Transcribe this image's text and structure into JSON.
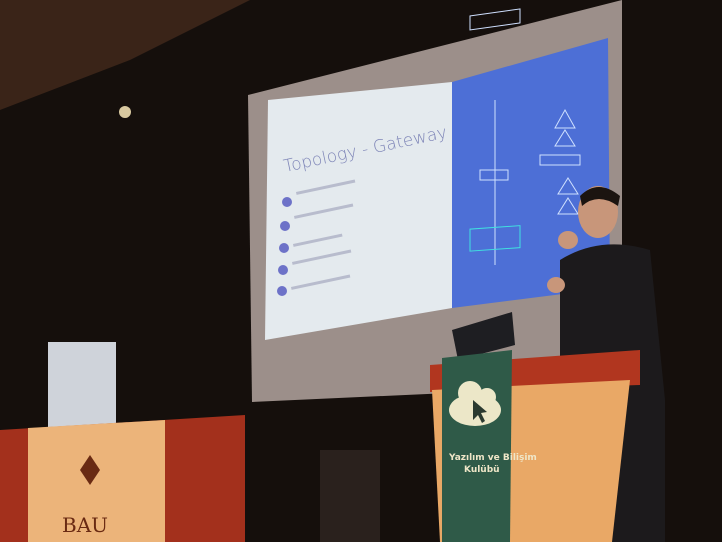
{
  "slide": {
    "title": "Topology - Gateway",
    "bullet_count": 5
  },
  "podium_banner": {
    "line1": "Yazılım ve Bilişim",
    "line2": "Kulübü",
    "icon": "cloud-cursor-icon"
  },
  "table_logo": {
    "text": "BAU"
  },
  "colors": {
    "background": "#150f0c",
    "slide_white": "#e6ecf0",
    "slide_blue": "#4d6fd6",
    "bullet": "#6d72c8",
    "podium_orange": "#e9a866",
    "podium_red": "#a52e1c",
    "banner_green": "#2f5a48"
  }
}
